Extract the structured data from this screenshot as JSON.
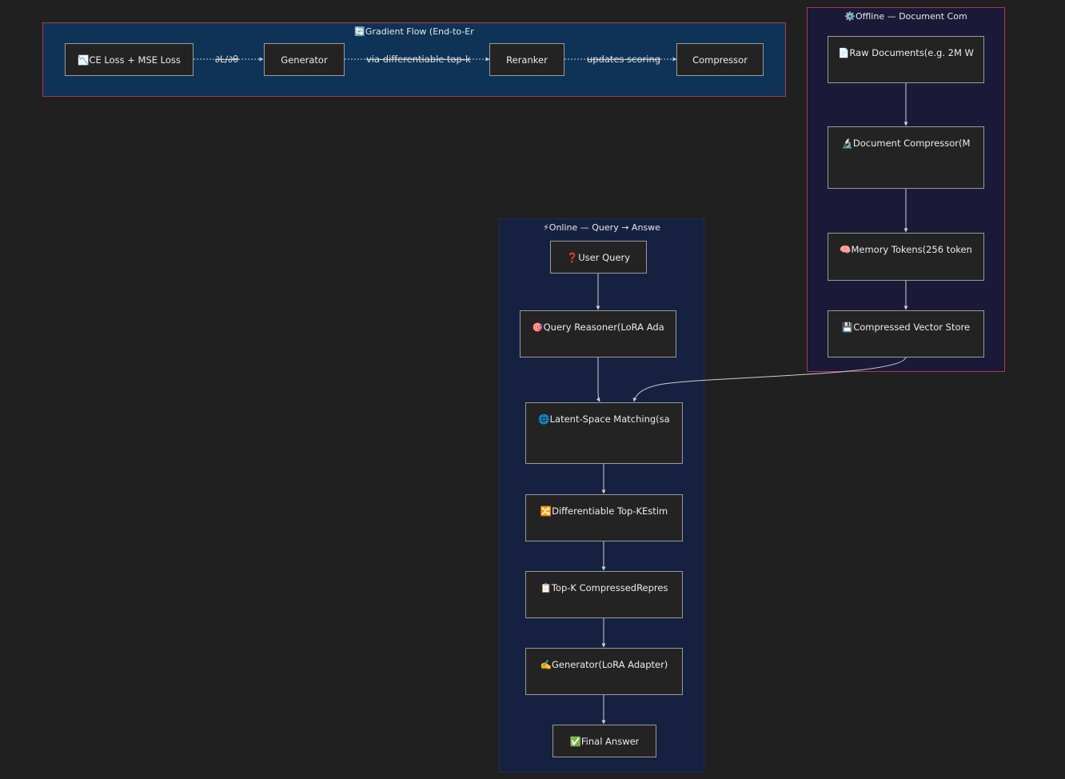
{
  "clusters": {
    "gradient": {
      "title": "🔄Gradient Flow (End-to-Er"
    },
    "offline": {
      "title": "⚙️Offline — Document Com"
    },
    "online": {
      "title": "⚡Online — Query → Answe"
    }
  },
  "nodes": {
    "ce_loss": "📉CE Loss + MSE Loss",
    "generator_grad": "Generator",
    "reranker": "Reranker",
    "compressor_grad": "Compressor",
    "raw_documents": "📄Raw Documents(e.g. 2M W",
    "document_compressor": "🔬Document Compressor(M",
    "memory_tokens": "🧠Memory Tokens(256 token",
    "compressed_vector_store": "💾Compressed Vector Store",
    "user_query": "❓User Query",
    "query_reasoner": "🎯Query Reasoner(LoRA Ada",
    "latent_matching": "🌐Latent-Space Matching(sa",
    "diff_topk": "🔀Differentiable Top-KEstim",
    "topk_compressed": "📋Top-K CompressedRepres",
    "generator_lora": "✍️Generator(LoRA Adapter)",
    "final_answer": "✅Final Answer"
  },
  "edge_labels": {
    "grad": "∂L/∂θ",
    "topk": "via differentiable top-k",
    "scoring": "updates scoring"
  },
  "colors": {
    "background": "#202020",
    "gradient_fill": "#0f3357",
    "offline_fill": "#1a1a38",
    "online_fill": "#162040",
    "cluster_border": "#b0364f",
    "online_border": "#1f3050",
    "node_border": "#9a9a9a",
    "edge": "#cfcfcf"
  }
}
